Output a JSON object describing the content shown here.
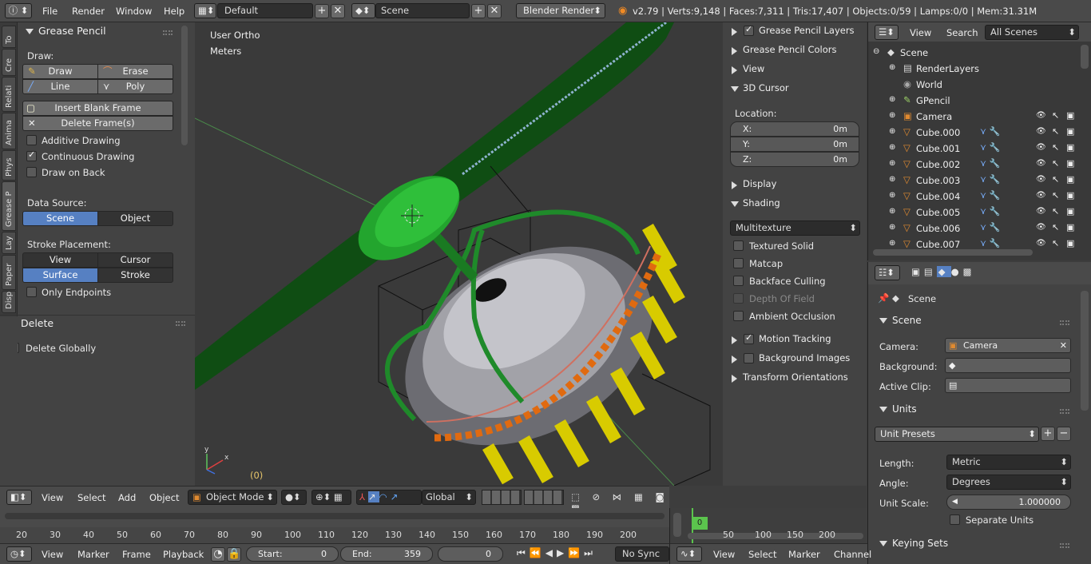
{
  "topbar": {
    "menu": [
      "File",
      "Render",
      "Window",
      "Help"
    ],
    "layout": "Default",
    "scene": "Scene",
    "engine": "Blender Render",
    "stats": "v2.79 | Verts:9,148 | Faces:7,311 | Tris:17,407 | Objects:0/59 | Lamps:0/0 | Mem:31.31M"
  },
  "tabs": [
    "To",
    "Cre",
    "Relati",
    "Anima",
    "Phys",
    "Grease P",
    "Lay",
    "Paper",
    "Disp"
  ],
  "toolshelf": {
    "panel_title": "Grease Pencil",
    "draw_label": "Draw:",
    "draw": "Draw",
    "erase": "Erase",
    "line": "Line",
    "poly": "Poly",
    "insert_blank": "Insert Blank Frame",
    "delete_frames": "Delete Frame(s)",
    "additive": "Additive Drawing",
    "continuous": "Continuous Drawing",
    "draw_on_back": "Draw on Back",
    "data_source": "Data Source:",
    "scene": "Scene",
    "object": "Object",
    "stroke_placement": "Stroke Placement:",
    "view": "View",
    "cursor": "Cursor",
    "surface": "Surface",
    "stroke": "Stroke",
    "only_endpoints": "Only Endpoints",
    "delete_title": "Delete",
    "delete_globally": "Delete Globally"
  },
  "viewport": {
    "view_name": "User Ortho",
    "units": "Meters",
    "frame": "(0)"
  },
  "npanel": {
    "gp_layers": "Grease Pencil Layers",
    "gp_colors": "Grease Pencil Colors",
    "view": "View",
    "cursor3d": "3D Cursor",
    "location": "Location:",
    "x_label": "X:",
    "x": "0m",
    "y_label": "Y:",
    "y": "0m",
    "z_label": "Z:",
    "z": "0m",
    "display": "Display",
    "shading": "Shading",
    "shading_mode": "Multitexture",
    "textured_solid": "Textured Solid",
    "matcap": "Matcap",
    "backface": "Backface Culling",
    "dof": "Depth Of Field",
    "ao": "Ambient Occlusion",
    "motion_tracking": "Motion Tracking",
    "bg_images": "Background Images",
    "transform_orient": "Transform Orientations"
  },
  "outliner": {
    "view": "View",
    "search": "Search",
    "filter": "All Scenes",
    "items": [
      "Scene",
      "RenderLayers",
      "World",
      "GPencil",
      "Camera",
      "Cube.000",
      "Cube.001",
      "Cube.002",
      "Cube.003",
      "Cube.004",
      "Cube.005",
      "Cube.006",
      "Cube.007"
    ]
  },
  "props": {
    "context": "Scene",
    "scene_panel": "Scene",
    "camera_label": "Camera:",
    "camera": "Camera",
    "background_label": "Background:",
    "active_clip_label": "Active Clip:",
    "units_panel": "Units",
    "unit_presets": "Unit Presets",
    "length_label": "Length:",
    "length": "Metric",
    "angle_label": "Angle:",
    "angle": "Degrees",
    "scale_label": "Unit Scale:",
    "scale": "1.000000",
    "separate_units": "Separate Units",
    "keying_sets": "Keying Sets"
  },
  "vheader": {
    "view": "View",
    "select": "Select",
    "add": "Add",
    "object": "Object",
    "mode": "Object Mode",
    "orientation": "Global"
  },
  "timeline": {
    "ticks": [
      "20",
      "30",
      "40",
      "50",
      "60",
      "70",
      "80",
      "90",
      "100",
      "110",
      "120",
      "130",
      "140",
      "150",
      "160",
      "170",
      "180",
      "190",
      "200"
    ],
    "current": "0",
    "graph_ticks": [
      "50",
      "100",
      "150",
      "200"
    ]
  },
  "tlheader": {
    "view": "View",
    "marker": "Marker",
    "frame": "Frame",
    "playback": "Playback",
    "start_label": "Start:",
    "start": "0",
    "end_label": "End:",
    "end": "359",
    "current": "0",
    "sync": "No Sync"
  },
  "graphheader": {
    "view": "View",
    "select": "Select",
    "marker": "Marker",
    "channel": "Channel"
  },
  "colors": {
    "accent_blue": "#5680c2",
    "viewport_bg": "#3a3a3a",
    "green_object": "#1f9a2a",
    "yellow": "#e0d000",
    "orange": "#e06a10"
  }
}
